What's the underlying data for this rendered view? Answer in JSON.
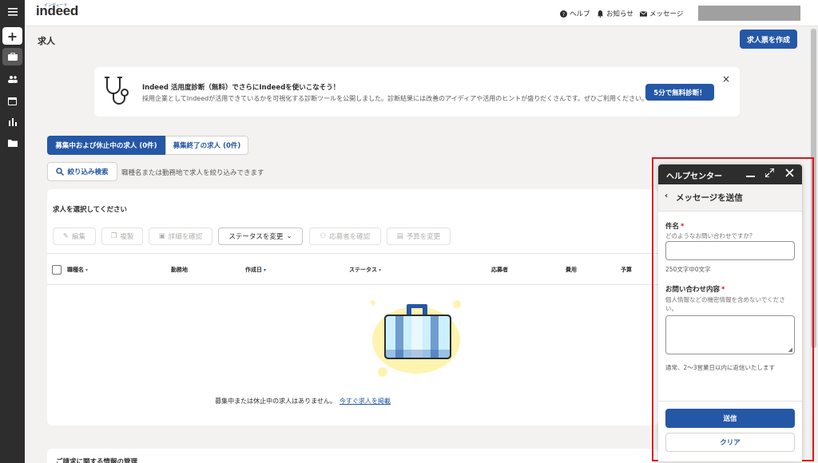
{
  "app": {
    "logo": "indeed",
    "logo_sub": "インディード"
  },
  "header": {
    "help": "ヘルプ",
    "notifications": "お知らせ",
    "messages": "メッセージ"
  },
  "sidebar": {
    "items": [
      "add-icon",
      "briefcase-icon",
      "people-icon",
      "calendar-icon",
      "bar-chart-icon",
      "folder-icon"
    ]
  },
  "page": {
    "title": "求人",
    "create_button": "求人票を作成"
  },
  "banner": {
    "title": "Indeed 活用度診断（無料）でさらにIndeedを使いこなそう！",
    "text": "採用企業としてIndeedが活用できているかを可視化する診断ツールを公開しました。診断結果には改善のアイディアや活用のヒントが盛りだくさんです。ぜひご利用ください。",
    "button": "5分で無料診断！",
    "close": "×"
  },
  "tabs": [
    {
      "label": "募集中および休止中の求人 (0件)",
      "active": true
    },
    {
      "label": "募集終了の求人 (0件)",
      "active": false
    }
  ],
  "filter": {
    "button": "絞り込み検索",
    "hint": "職種名または勤務地で求人を絞り込みできます"
  },
  "jobs": {
    "select_prompt": "求人を選択してください",
    "toolbar": {
      "edit": "編集",
      "copy": "複製",
      "details": "詳細を確認",
      "status": "ステータスを変更",
      "applicants": "応募者を確認",
      "budget": "予算を変更"
    },
    "columns": [
      "職種名",
      "勤務地",
      "作成日",
      "ステータス",
      "応募者",
      "費用",
      "予算"
    ],
    "empty_message": "募集中または休止中の求人はありません。",
    "empty_link": "今すぐ求人を掲載"
  },
  "billing": {
    "title": "ご請求に関する情報の管理"
  },
  "help_panel": {
    "title": "ヘルプセンター",
    "subtitle": "メッセージを送信",
    "subject_label": "件名",
    "subject_hint": "どのようなお問い合わせですか？",
    "subject_value": "",
    "char_counter": "250文字中0文字",
    "content_label": "お問い合わせ内容",
    "content_hint": "個人情報などの機密情報を含めないでください。",
    "content_value": "",
    "reply_note": "通常、2～3営業日以内に返信いたします",
    "send_button": "送信",
    "clear_button": "クリア"
  },
  "colors": {
    "brand_blue": "#2557a7",
    "dark": "#2d2d2d",
    "highlight_frame": "#e0141e"
  }
}
